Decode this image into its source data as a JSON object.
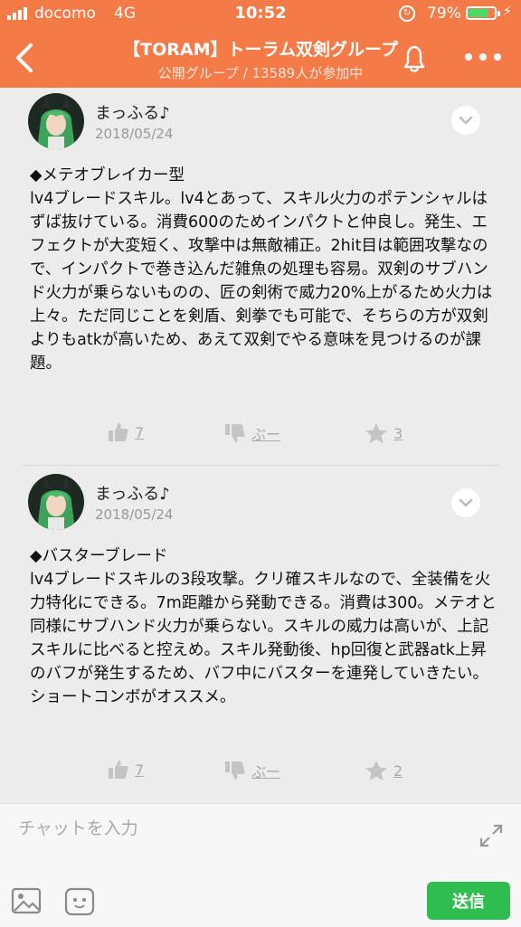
{
  "status_bar": {
    "carrier": "docomo",
    "network": "4G",
    "time": "10:52",
    "battery": "79%",
    "battery_level": 0.79
  },
  "header": {
    "title": "【TORAM】トーラム双剣グループ",
    "subtitle": "公開グループ / 13589人が参加中",
    "back_icon": "chevron-left-icon",
    "bell_icon": "bell-icon",
    "more_icon": "more-dots-icon"
  },
  "posts": [
    {
      "author": "まっふる♪",
      "date": "2018/05/24",
      "text": "◆メテオブレイカー型\nlv4ブレードスキル。lv4とあって、スキル火力のポテンシャルはずば抜けている。消費600のためインパクトと仲良し。発生、エフェクトが大変短く、攻撃中は無敵補正。2hit目は範囲攻撃なので、インパクトで巻き込んだ雑魚の処理も容易。双剣のサブハンド火力が乗らないものの、匠の剣術で威力20%上がるため火力は上々。ただ同じことを剣盾、剣拳でも可能で、そちらの方が双剣よりもatkが高いため、あえて双剣でやる意味を見つけるのが課題。",
      "likes": "7",
      "boo_label": "ぶー",
      "stars": "3"
    },
    {
      "author": "まっふる♪",
      "date": "2018/05/24",
      "text": "◆バスターブレード\nlv4ブレードスキルの3段攻撃。クリ確スキルなので、全装備を火力特化にできる。7m距離から発動できる。消費は300。メテオと同様にサブハンド火力が乗らない。スキルの威力は高いが、上記スキルに比べると控えめ。スキル発動後、hp回復と武器atk上昇のバフが発生するため、バフ中にバスターを連発していきたい。ショートコンボがオススメ。",
      "likes": "7",
      "boo_label": "ぶー",
      "stars": "2"
    }
  ],
  "composer": {
    "placeholder": "チャットを入力",
    "send_label": "送信"
  },
  "colors": {
    "header": "#f47b48",
    "send_button": "#2ebd4e",
    "background": "#ececec"
  }
}
